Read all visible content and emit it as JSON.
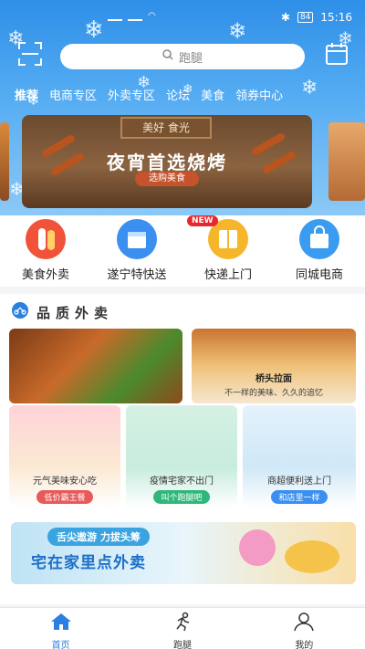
{
  "status": {
    "time": "15:16",
    "battery": "84",
    "network": "4G"
  },
  "search": {
    "placeholder": "跑腿"
  },
  "tabs": [
    {
      "label": "推荐"
    },
    {
      "label": "电商专区"
    },
    {
      "label": "外卖专区"
    },
    {
      "label": "论坛"
    },
    {
      "label": "美食"
    },
    {
      "label": "领券中心"
    }
  ],
  "banner": {
    "sign": "美好 食光",
    "title": "夜宵首选烧烤",
    "button": "选购美食"
  },
  "categories": [
    {
      "label": "美食外卖",
      "icon": "food-delivery-icon",
      "color": "#f0533a"
    },
    {
      "label": "遂宁特快送",
      "icon": "express-box-icon",
      "color": "#3a8ff0"
    },
    {
      "label": "快递上门",
      "icon": "parcel-icon",
      "color": "#f5b62b",
      "badge": "NEW"
    },
    {
      "label": "同城电商",
      "icon": "shop-bag-icon",
      "color": "#3a9cf0"
    }
  ],
  "section": {
    "title": "品质外卖"
  },
  "cards": {
    "noodle": {
      "title": "桥头拉面",
      "subtitle": "不一样的美味、久久的追忆"
    },
    "fruit": {
      "title": "元气美味安心吃",
      "pill": "低价霸王餐"
    },
    "shrimp": {
      "title": "疫情宅家不出门",
      "pill": "叫个跑腿吧"
    },
    "meat": {
      "title": "商超便利送上门",
      "pill": "和店里一样"
    }
  },
  "bottom_banner": {
    "line1": "舌尖遨游 力拔头筹",
    "line2": "宅在家里点外卖"
  },
  "nav": [
    {
      "label": "首页",
      "icon": "home-icon"
    },
    {
      "label": "跑腿",
      "icon": "runner-icon"
    },
    {
      "label": "我的",
      "icon": "user-icon"
    }
  ],
  "colors": {
    "accent": "#2a7fe0",
    "header": "#2e8fe8"
  }
}
